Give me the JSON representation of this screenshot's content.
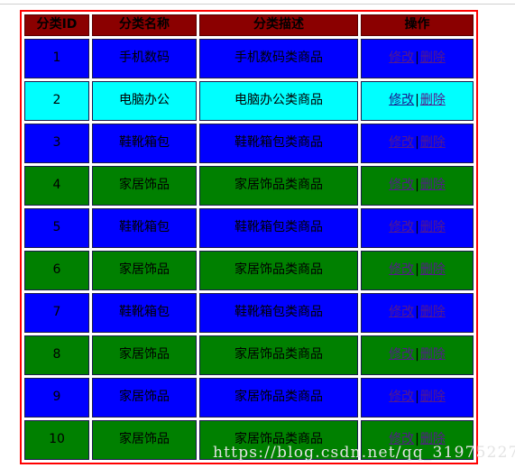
{
  "page": {
    "watermark": "https://blog.csdn.net/qq_31975227",
    "accent_border": "#ff0000",
    "header_bg": "#8b0000",
    "row_blue": "#0000ff",
    "row_cyan": "#00ffff",
    "row_green": "#008000",
    "link_color": "#551a8b"
  },
  "table": {
    "headers": [
      {
        "label": "分类ID"
      },
      {
        "label": "分类名称"
      },
      {
        "label": "分类描述"
      },
      {
        "label": "操作"
      }
    ],
    "ops": {
      "edit_label": "修改",
      "separator": "|",
      "delete_label": "删除"
    },
    "rows": [
      {
        "id": "1",
        "name": "手机数码",
        "desc": "手机数码类商品",
        "color": "blue"
      },
      {
        "id": "2",
        "name": "电脑办公",
        "desc": "电脑办公类商品",
        "color": "cyan"
      },
      {
        "id": "3",
        "name": "鞋靴箱包",
        "desc": "鞋靴箱包类商品",
        "color": "blue"
      },
      {
        "id": "4",
        "name": "家居饰品",
        "desc": "家居饰品类商品",
        "color": "green"
      },
      {
        "id": "5",
        "name": "鞋靴箱包",
        "desc": "鞋靴箱包类商品",
        "color": "blue"
      },
      {
        "id": "6",
        "name": "家居饰品",
        "desc": "家居饰品类商品",
        "color": "green"
      },
      {
        "id": "7",
        "name": "鞋靴箱包",
        "desc": "鞋靴箱包类商品",
        "color": "blue"
      },
      {
        "id": "8",
        "name": "家居饰品",
        "desc": "家居饰品类商品",
        "color": "green"
      },
      {
        "id": "9",
        "name": "家居饰品",
        "desc": "家居饰品类商品",
        "color": "blue"
      },
      {
        "id": "10",
        "name": "家居饰品",
        "desc": "家居饰品类商品",
        "color": "green"
      }
    ]
  }
}
